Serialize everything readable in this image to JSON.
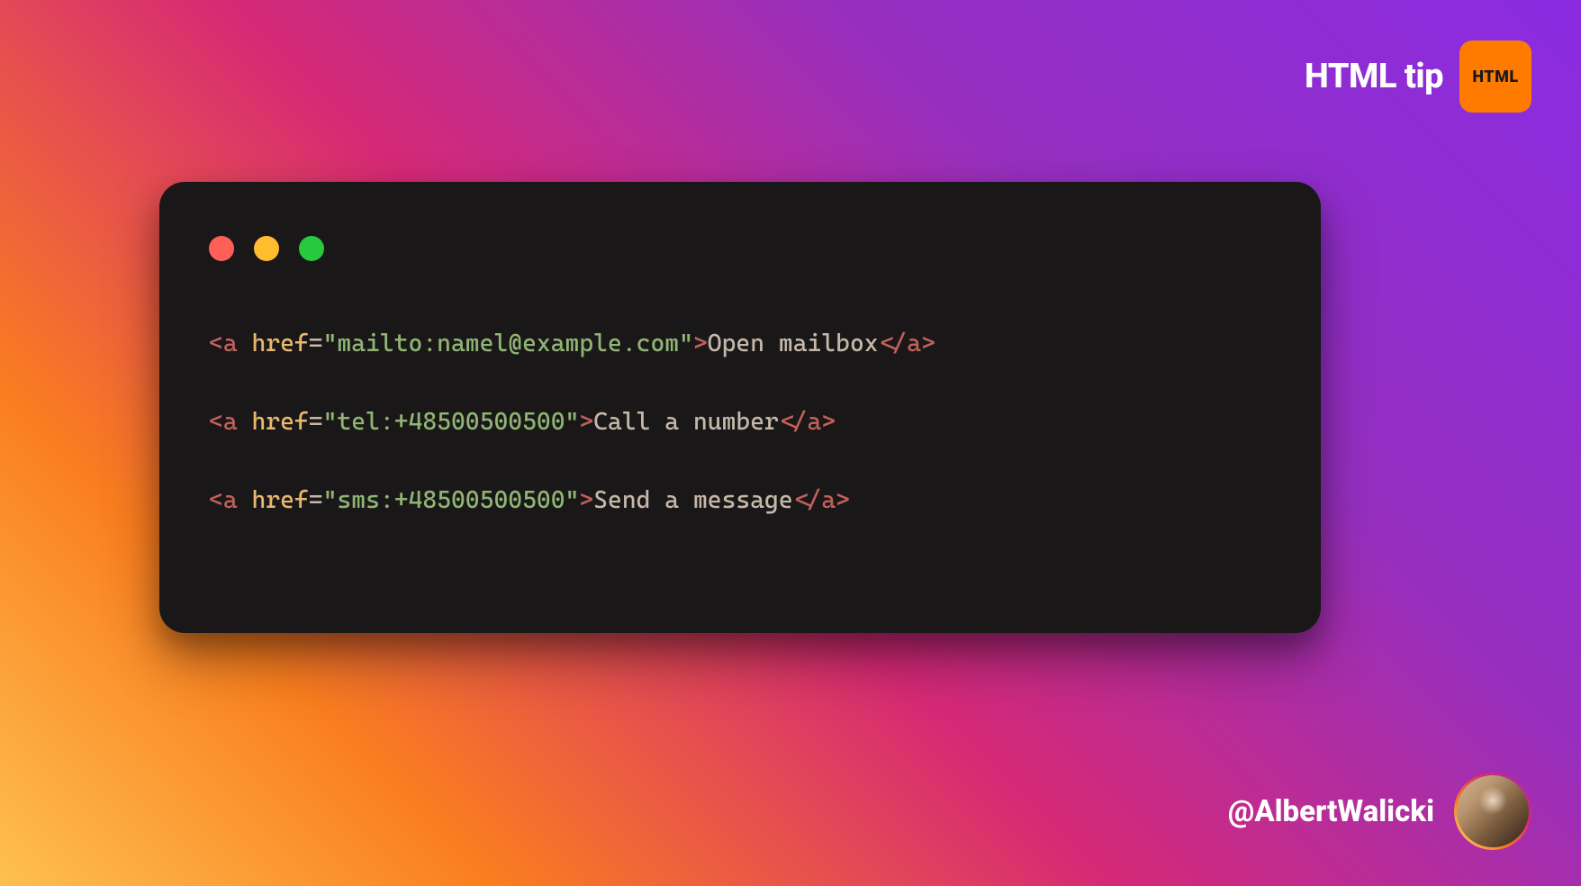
{
  "header": {
    "title": "HTML tip",
    "badge": "HTML"
  },
  "code": {
    "lines": [
      {
        "tag_open": "<",
        "tag_name": "a",
        "attr_name": "href",
        "equals": "=",
        "q1": "\"",
        "attr_value": "mailto:namel@example.com",
        "q2": "\"",
        "tag_close": ">",
        "text": "Open mailbox",
        "close_open": "</",
        "close_name": "a",
        "close_close": ">"
      },
      {
        "tag_open": "<",
        "tag_name": "a",
        "attr_name": "href",
        "equals": "=",
        "q1": "\"",
        "attr_value": "tel:+48500500500",
        "q2": "\"",
        "tag_close": ">",
        "text": "Call a number",
        "close_open": "</",
        "close_name": "a",
        "close_close": ">"
      },
      {
        "tag_open": "<",
        "tag_name": "a",
        "attr_name": "href",
        "equals": "=",
        "q1": "\"",
        "attr_value": "sms:+48500500500",
        "q2": "\"",
        "tag_close": ">",
        "text": "Send a message",
        "close_open": "</",
        "close_name": "a",
        "close_close": ">"
      }
    ]
  },
  "footer": {
    "handle": "@AlbertWalicki"
  }
}
